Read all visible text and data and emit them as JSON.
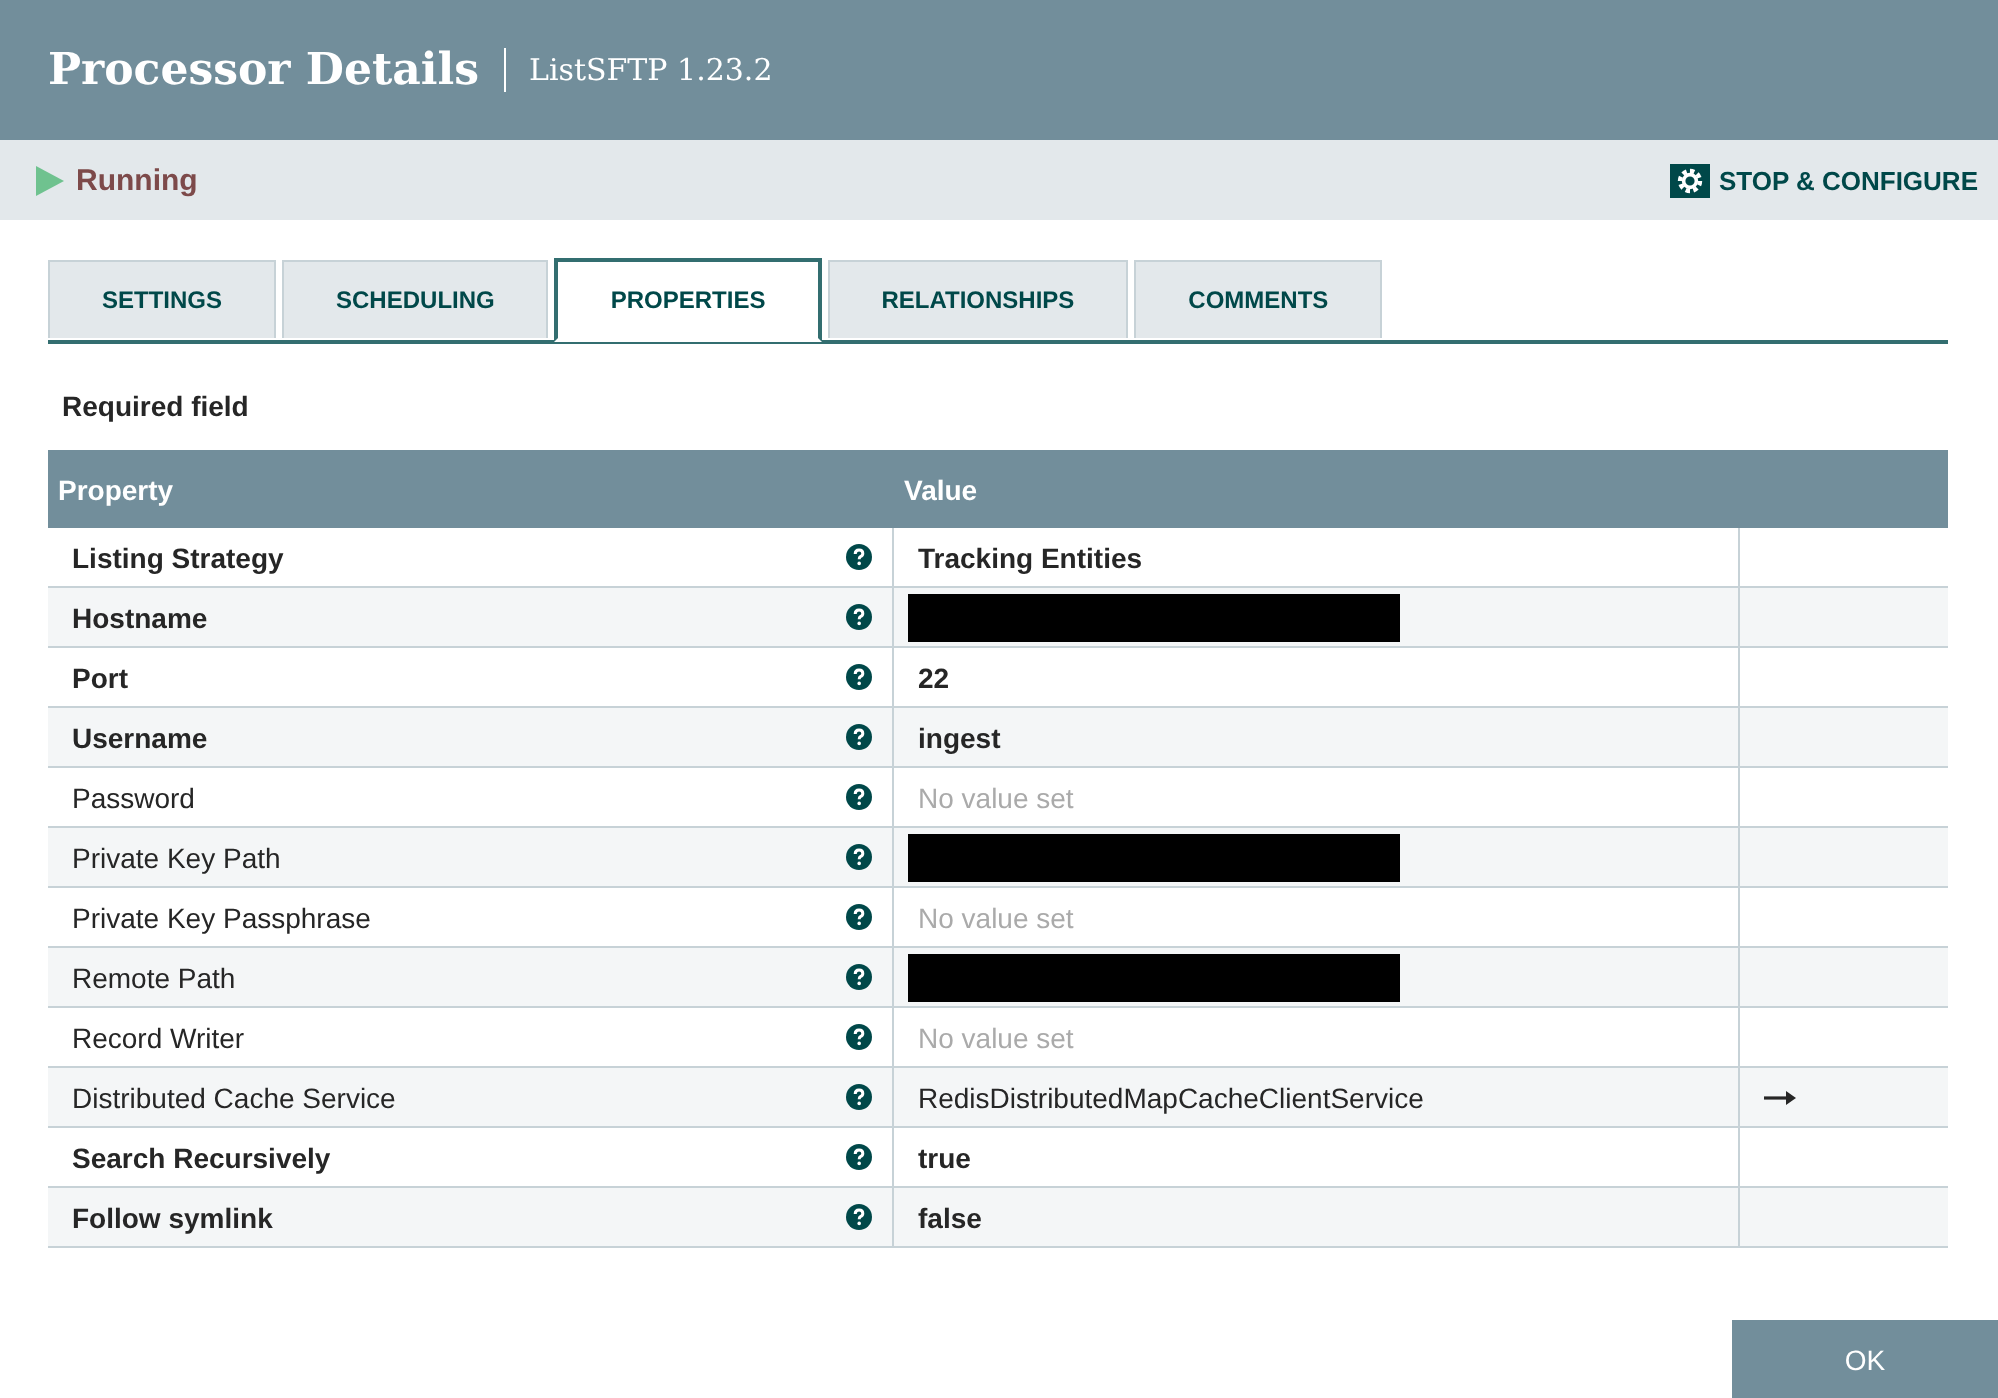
{
  "dialog": {
    "title": "Processor Details",
    "subtitle": "ListSFTP 1.23.2"
  },
  "status": {
    "label": "Running",
    "running": true,
    "action": "STOP & CONFIGURE"
  },
  "tabs": [
    {
      "label": "SETTINGS",
      "selected": false
    },
    {
      "label": "SCHEDULING",
      "selected": false
    },
    {
      "label": "PROPERTIES",
      "selected": true
    },
    {
      "label": "RELATIONSHIPS",
      "selected": false
    },
    {
      "label": "COMMENTS",
      "selected": false
    }
  ],
  "required_note": "Required field",
  "table": {
    "columns": [
      "Property",
      "Value"
    ],
    "rows": [
      {
        "name": "Listing Strategy",
        "required": true,
        "kind": "text",
        "value": "Tracking Entities",
        "link": false
      },
      {
        "name": "Hostname",
        "required": true,
        "kind": "redacted",
        "link": false
      },
      {
        "name": "Port",
        "required": true,
        "kind": "text",
        "value": "22",
        "link": false
      },
      {
        "name": "Username",
        "required": true,
        "kind": "text",
        "value": "ingest",
        "link": false
      },
      {
        "name": "Password",
        "required": false,
        "kind": "empty",
        "value": "No value set",
        "link": false
      },
      {
        "name": "Private Key Path",
        "required": false,
        "kind": "redacted",
        "link": false
      },
      {
        "name": "Private Key Passphrase",
        "required": false,
        "kind": "empty",
        "value": "No value set",
        "link": false
      },
      {
        "name": "Remote Path",
        "required": false,
        "kind": "redacted",
        "link": false
      },
      {
        "name": "Record Writer",
        "required": false,
        "kind": "empty",
        "value": "No value set",
        "link": false
      },
      {
        "name": "Distributed Cache Service",
        "required": false,
        "kind": "text",
        "value": "RedisDistributedMapCacheClientService",
        "link": true
      },
      {
        "name": "Search Recursively",
        "required": true,
        "kind": "text",
        "value": "true",
        "link": false
      },
      {
        "name": "Follow symlink",
        "required": true,
        "kind": "text",
        "value": "false",
        "link": false
      }
    ]
  },
  "ok_button": "OK"
}
